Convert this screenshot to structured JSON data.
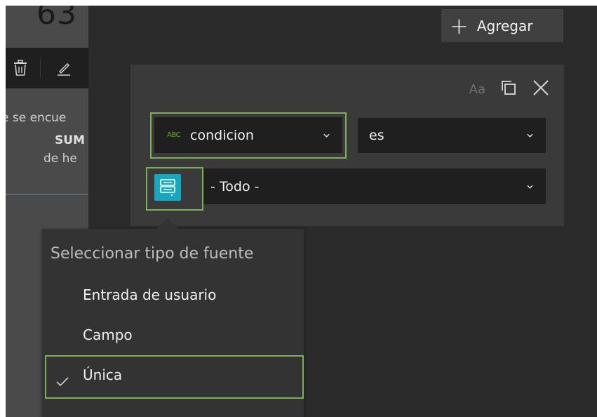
{
  "left_panel": {
    "big_number": "63",
    "text_lines": [
      "e se encue",
      "SUM",
      "de he"
    ]
  },
  "header": {
    "add_button_label": "Agregar"
  },
  "filter_card": {
    "font_toggle_label": "Aa",
    "field_select": {
      "type_badge": "ABC",
      "value": "condicion"
    },
    "operator_select": {
      "value": "es"
    },
    "value_select": {
      "value": "- Todo -"
    }
  },
  "source_type_menu": {
    "title": "Seleccionar tipo de fuente",
    "items": [
      {
        "label": "Entrada de usuario",
        "selected": false
      },
      {
        "label": "Campo",
        "selected": false
      },
      {
        "label": "Única",
        "selected": true
      }
    ]
  },
  "colors": {
    "highlight": "#77b255",
    "accent_teal": "#16a8be",
    "abc_green": "#5bb318"
  }
}
